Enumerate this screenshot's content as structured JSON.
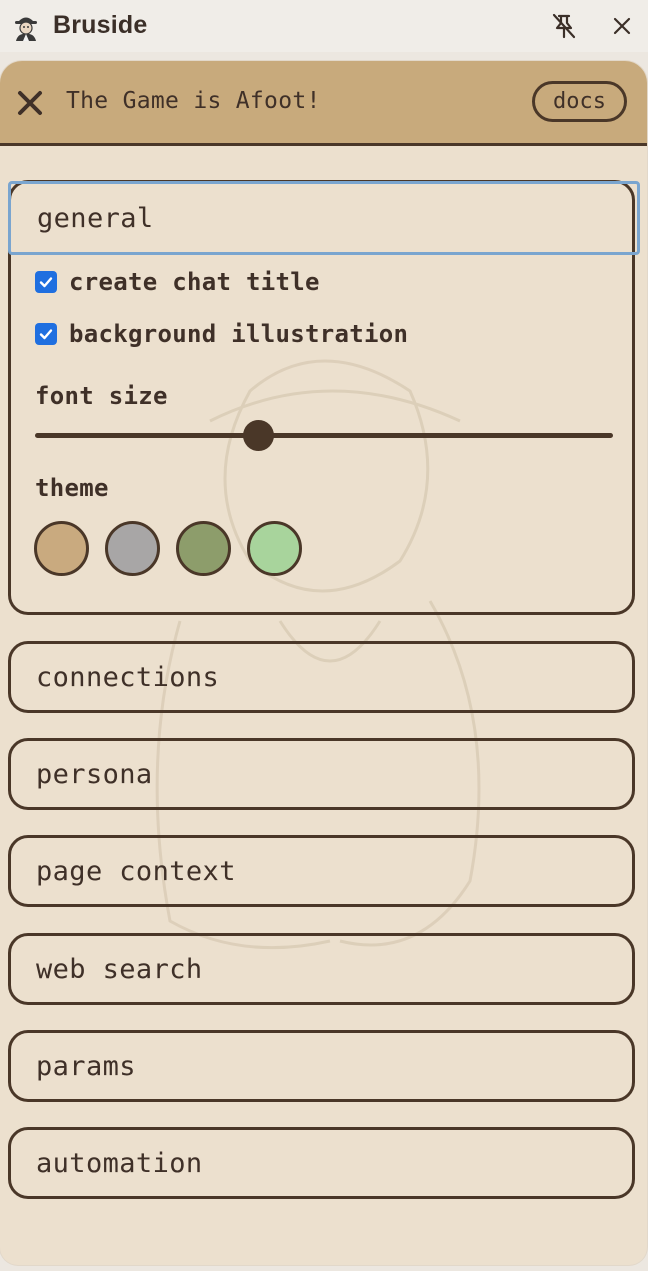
{
  "window": {
    "app_title": "Bruside",
    "logo_icon": "detective-icon",
    "unpin_icon": "unpin-icon",
    "close_icon": "close-icon"
  },
  "header": {
    "title": "The Game is Afoot!",
    "close_icon": "close-icon",
    "docs_label": "docs"
  },
  "general": {
    "label": "general",
    "create_chat_title": {
      "label": "create chat title",
      "checked": true
    },
    "background_illustration": {
      "label": "background illustration",
      "checked": true
    },
    "font_size": {
      "label": "font size",
      "value": 0.385
    },
    "theme": {
      "label": "theme",
      "options": [
        {
          "name": "tan",
          "color": "#c9aa7f"
        },
        {
          "name": "gray",
          "color": "#a8a6a6"
        },
        {
          "name": "olive",
          "color": "#8d9d6b"
        },
        {
          "name": "mint",
          "color": "#a8d49c"
        }
      ]
    }
  },
  "sections": [
    {
      "label": "connections"
    },
    {
      "label": "persona"
    },
    {
      "label": "page context"
    },
    {
      "label": "web search"
    },
    {
      "label": "params"
    },
    {
      "label": "automation"
    }
  ],
  "colors": {
    "accent": "#4a3728",
    "header_bg": "#c8aa7c",
    "panel_bg": "#ece0ce",
    "focus_ring": "#7aa5cf",
    "checkbox": "#1f6fe0"
  }
}
